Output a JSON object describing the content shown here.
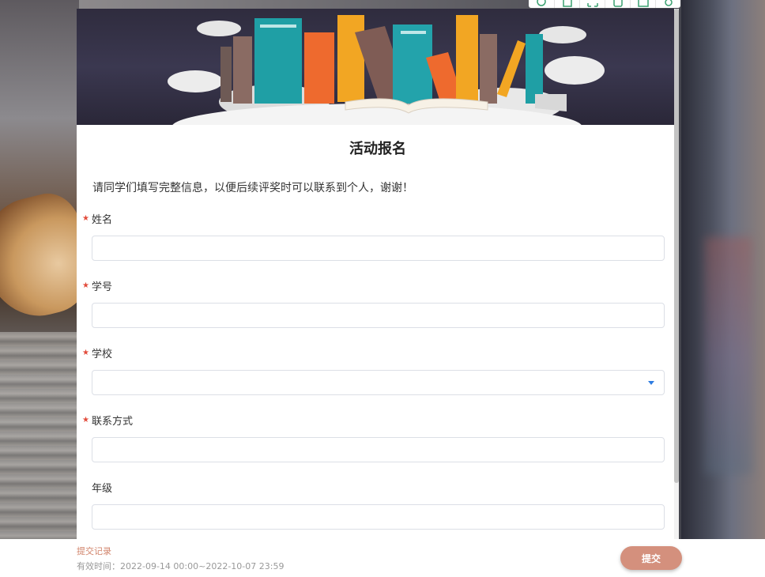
{
  "toolbar": {
    "icons": [
      "search-icon",
      "document-icon",
      "expand-icon",
      "share-icon",
      "message-icon",
      "settings-icon"
    ]
  },
  "form": {
    "title": "活动报名",
    "description": "请同学们填写完整信息，以便后续评奖时可以联系到个人，谢谢！",
    "required_mark": "★",
    "fields": [
      {
        "label": "姓名",
        "required": true,
        "type": "text",
        "value": ""
      },
      {
        "label": "学号",
        "required": true,
        "type": "text",
        "value": ""
      },
      {
        "label": "学校",
        "required": true,
        "type": "select",
        "value": ""
      },
      {
        "label": "联系方式",
        "required": true,
        "type": "text",
        "value": ""
      },
      {
        "label": "年级",
        "required": false,
        "type": "text",
        "value": ""
      }
    ]
  },
  "footer": {
    "records_link": "提交记录",
    "validity": "有效时间：2022-09-14 00:00~2022-10-07 23:59",
    "submit_label": "提交"
  },
  "colors": {
    "accent": "#d4907d",
    "required": "#e24b3b",
    "select_caret": "#2f7de1"
  }
}
